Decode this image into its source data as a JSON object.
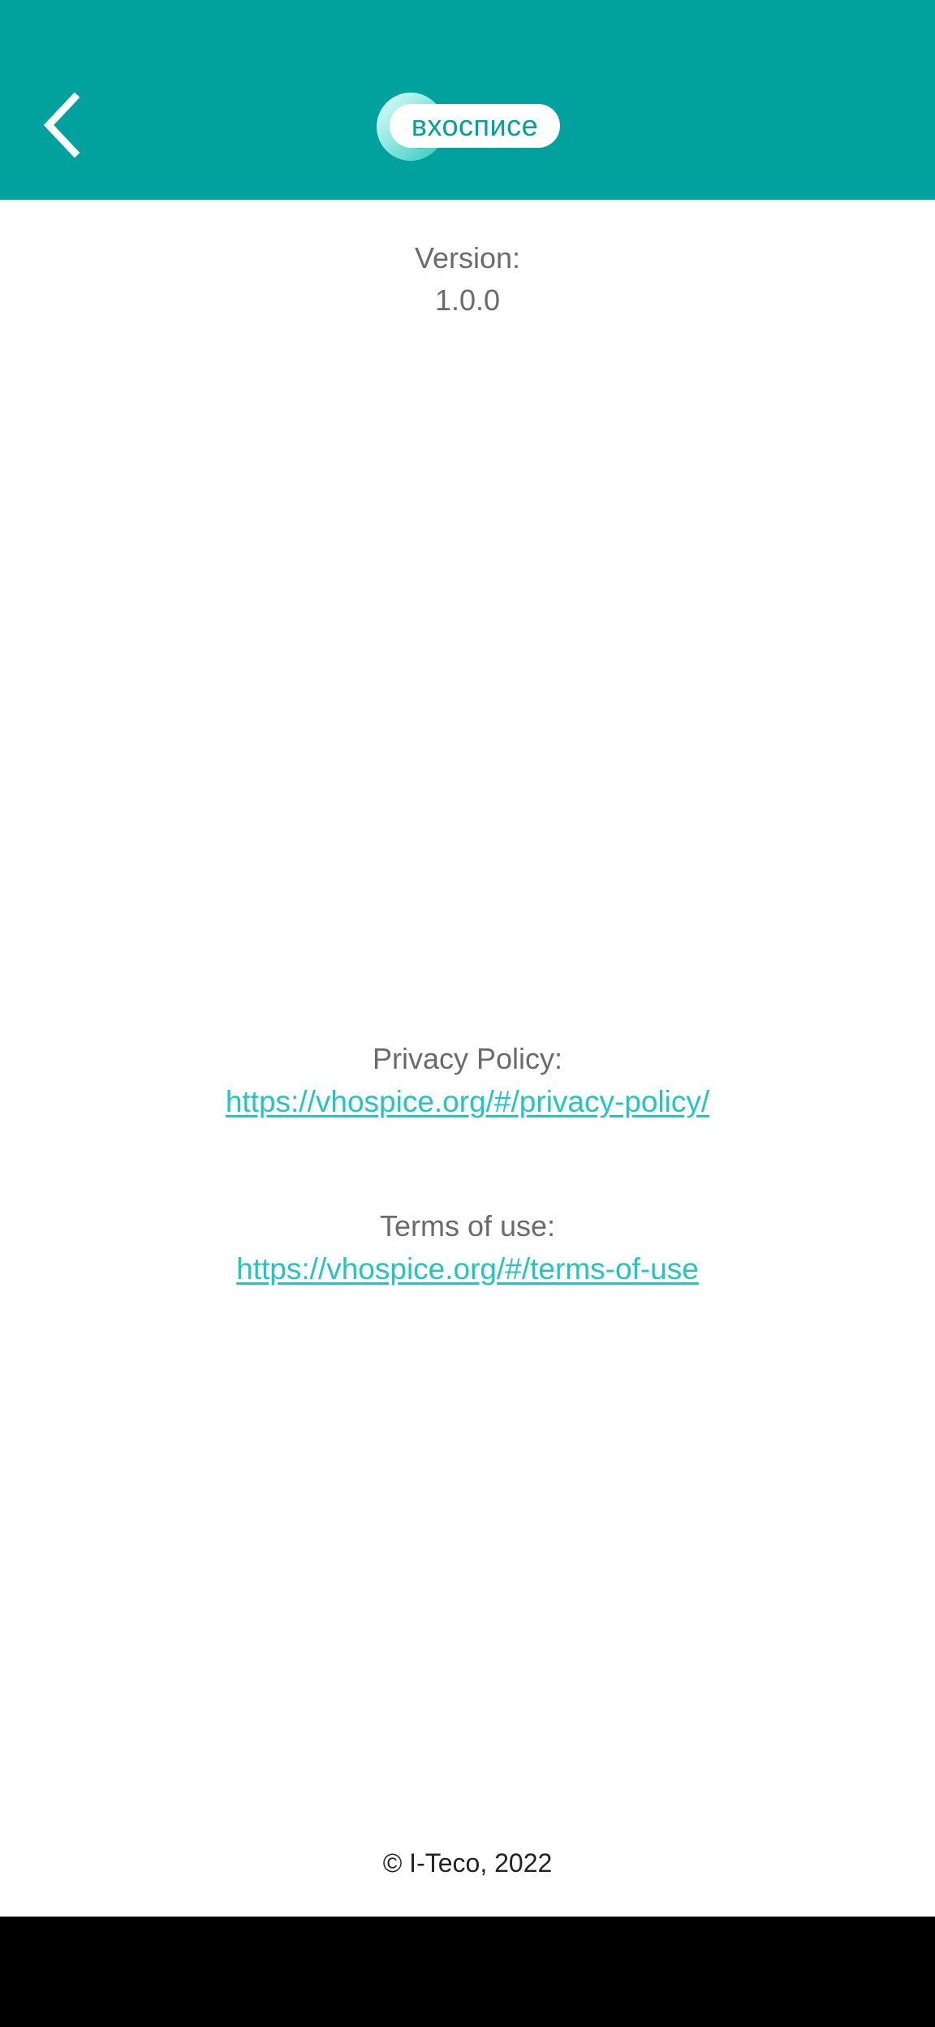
{
  "header": {
    "back_icon": "chevron-left-icon",
    "logo_text": "вхосписе",
    "background_color": "#01a29e"
  },
  "version": {
    "label": "Version:",
    "value": "1.0.0"
  },
  "privacy": {
    "label": "Privacy Policy:",
    "url": "https://vhospice.org/#/privacy-policy/"
  },
  "terms": {
    "label": "Terms of use:",
    "url": "https://vhospice.org/#/terms-of-use"
  },
  "footer": {
    "copyright": "© I-Teco, 2022"
  },
  "colors": {
    "accent": "#01a29e",
    "link": "#22c6c0",
    "label": "#6b6b6b"
  }
}
